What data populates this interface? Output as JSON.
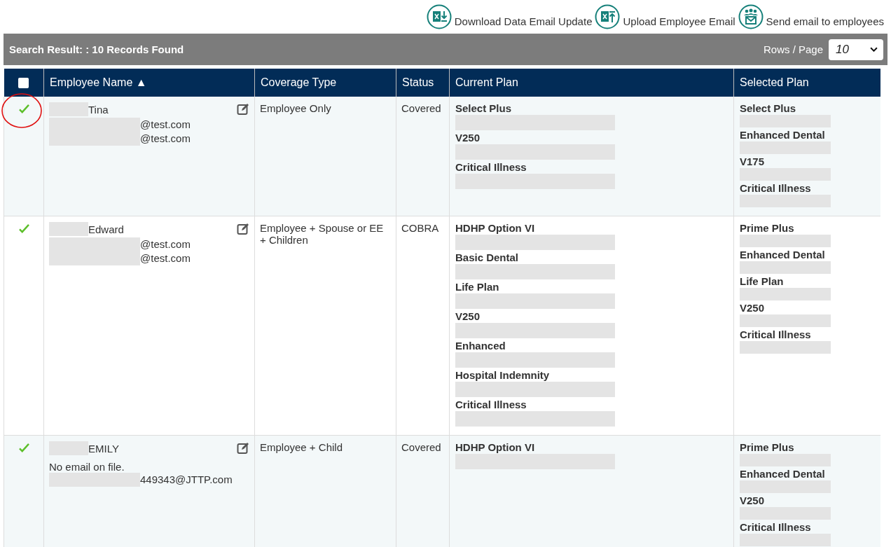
{
  "toolbar": [
    {
      "label": "Download Data Email Update",
      "kind": "download"
    },
    {
      "label": "Upload Employee Email",
      "kind": "upload"
    },
    {
      "label": "Send email to employees",
      "kind": "send"
    }
  ],
  "results_bar": {
    "summary": "Search Result: : 10 Records Found",
    "rows_label": "Rows / Page",
    "rows_value": "10"
  },
  "table": {
    "select_all": {
      "checked": false
    },
    "columns": [
      "Employee Name ▲",
      "Coverage Type",
      "Status",
      "Current Plan",
      "Selected Plan"
    ],
    "rows": [
      {
        "confirmed": true,
        "name": "Tina",
        "emails": [
          "@test.com",
          "@test.com"
        ],
        "coverage": "Employee Only",
        "status": "Covered",
        "current_plan": [
          "Select Plus",
          "V250",
          "Critical Illness"
        ],
        "selected_plan": [
          "Select Plus",
          "Enhanced Dental",
          "V175",
          "Critical Illness"
        ]
      },
      {
        "confirmed": true,
        "name": "Edward",
        "emails": [
          "@test.com",
          "@test.com"
        ],
        "coverage": "Employee + Spouse or EE + Children",
        "status": "COBRA",
        "current_plan": [
          "HDHP Option VI",
          "Basic Dental",
          "Life Plan",
          "V250",
          "Enhanced",
          "Hospital Indemnity",
          "Critical Illness"
        ],
        "selected_plan": [
          "Prime Plus",
          "Enhanced Dental",
          "Life Plan",
          "V250",
          "Critical Illness"
        ]
      },
      {
        "confirmed": true,
        "name": "EMILY",
        "note": "No email on file.",
        "emails": [
          "449343@JTTP.com"
        ],
        "coverage": "Employee + Child",
        "status": "Covered",
        "current_plan": [
          "HDHP Option VI"
        ],
        "selected_plan": [
          "Prime Plus",
          "Enhanced Dental",
          "V250",
          "Critical Illness"
        ]
      }
    ]
  }
}
